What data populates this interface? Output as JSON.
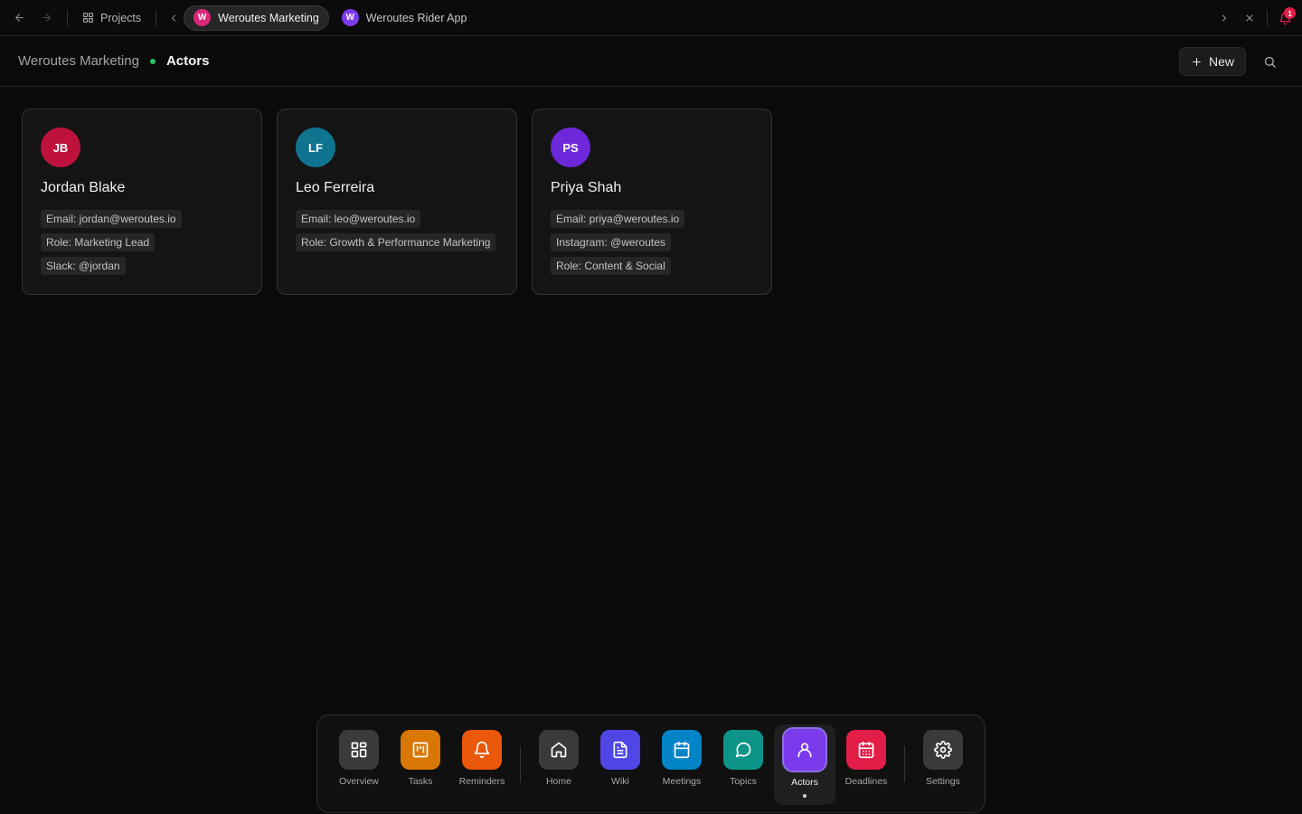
{
  "topbar": {
    "projects_label": "Projects",
    "tabs": [
      {
        "initial": "W",
        "label": "Weroutes Marketing",
        "color": "#db2777",
        "active": true
      },
      {
        "initial": "W",
        "label": "Weroutes Rider App",
        "color": "#7c3aed",
        "active": false
      }
    ],
    "notification_count": "1"
  },
  "header": {
    "breadcrumb_parent": "Weroutes Marketing",
    "breadcrumb_current": "Actors",
    "new_label": "New"
  },
  "actors": [
    {
      "initials": "JB",
      "name": "Jordan Blake",
      "color": "#be123c",
      "attrs": [
        "Email: jordan@weroutes.io",
        "Role: Marketing Lead",
        "Slack: @jordan"
      ]
    },
    {
      "initials": "LF",
      "name": "Leo Ferreira",
      "color": "#0e7490",
      "attrs": [
        "Email: leo@weroutes.io",
        "Role: Growth & Performance Marketing"
      ]
    },
    {
      "initials": "PS",
      "name": "Priya Shah",
      "color": "#6d28d9",
      "attrs": [
        "Email: priya@weroutes.io",
        "Instagram: @weroutes",
        "Role: Content & Social"
      ]
    }
  ],
  "dock": [
    {
      "label": "Overview",
      "icon": "grid-icon",
      "color": "#3a3a3a"
    },
    {
      "label": "Tasks",
      "icon": "kanban-icon",
      "color": "#d97706"
    },
    {
      "label": "Reminders",
      "icon": "bell-icon",
      "color": "#ea580c"
    },
    {
      "label": "Home",
      "icon": "home-icon",
      "color": "#3a3a3a"
    },
    {
      "label": "Wiki",
      "icon": "document-icon",
      "color": "#4f46e5"
    },
    {
      "label": "Meetings",
      "icon": "calendar-icon",
      "color": "#0284c7"
    },
    {
      "label": "Topics",
      "icon": "chat-bubble-icon",
      "color": "#0d9488"
    },
    {
      "label": "Actors",
      "icon": "user-icon",
      "color": "#7c3aed",
      "active": true
    },
    {
      "label": "Deadlines",
      "icon": "calendar-grid-icon",
      "color": "#e11d48"
    },
    {
      "label": "Settings",
      "icon": "gear-icon",
      "color": "#3a3a3a"
    }
  ]
}
